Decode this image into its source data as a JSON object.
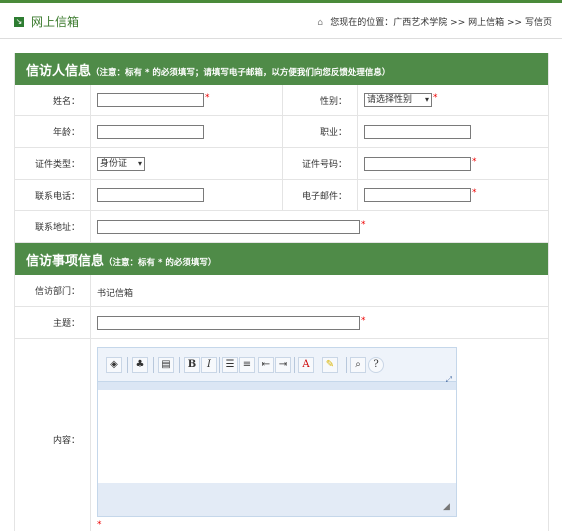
{
  "header": {
    "title": "网上信箱",
    "breadcrumb_prefix": "您现在的位置：",
    "breadcrumb_items": [
      "广西艺术学院",
      ">>",
      "网上信箱",
      ">>",
      "写信页"
    ]
  },
  "sections": {
    "petitioner": {
      "title": "信访人信息",
      "note": "（注意：标有 * 的必须填写；请填写电子邮箱，以方便我们向您反馈处理信息）"
    },
    "matter": {
      "title": "信访事项信息",
      "note": "（注意：标有 * 的必须填写）"
    }
  },
  "fields": {
    "name": {
      "label": "姓名：",
      "value": ""
    },
    "gender": {
      "label": "性别：",
      "selected": "请选择性别"
    },
    "age": {
      "label": "年龄：",
      "value": ""
    },
    "occupation": {
      "label": "职业：",
      "value": ""
    },
    "id_type": {
      "label": "证件类型：",
      "selected": "身份证"
    },
    "id_number": {
      "label": "证件号码：",
      "value": ""
    },
    "phone": {
      "label": "联系电话：",
      "value": ""
    },
    "email": {
      "label": "电子邮件：",
      "value": ""
    },
    "address": {
      "label": "联系地址：",
      "value": ""
    },
    "department": {
      "label": "信访部门：",
      "value": "书记信箱"
    },
    "subject": {
      "label": "主题：",
      "value": ""
    },
    "content": {
      "label": "内容："
    }
  },
  "required_mark": "*",
  "editor": {
    "buttons": [
      "source",
      "preview",
      "template",
      "bold",
      "italic",
      "ordered-list",
      "unordered-list",
      "outdent",
      "indent",
      "font-color",
      "highlight",
      "find",
      "about"
    ]
  },
  "colors": {
    "section_bg": "#4f8b48",
    "title_green": "#3a7a2c",
    "required": "#ee0000"
  }
}
